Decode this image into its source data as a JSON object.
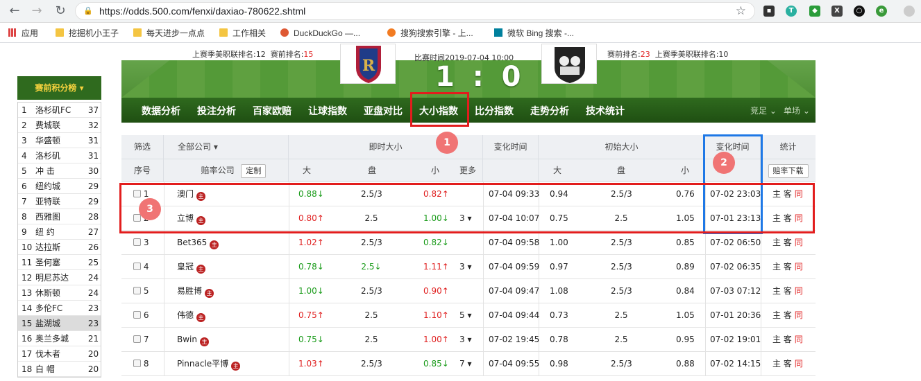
{
  "browser": {
    "url": "https://odds.500.com/fenxi/daxiao-780622.shtml",
    "bookmarks": [
      "应用",
      "挖掘机小王子",
      "每天进步一点点",
      "工作相关",
      "DuckDuckGo —...",
      "搜狗搜索引擎 - 上...",
      "微软 Bing 搜索 -..."
    ],
    "extensions": [
      "T",
      "X"
    ]
  },
  "match": {
    "left_rank_label": "上赛季美职联排名:12",
    "left_pre_label": "赛前排名:",
    "left_pre_value": "15",
    "time": "比赛时间2019-07-04 10:00",
    "score": "1 : 0",
    "right_pre_label": "赛前排名:",
    "right_pre_value": "23",
    "right_rank_label": "上赛季美职联排名:10"
  },
  "tabs": [
    "数据分析",
    "投注分析",
    "百家欧赔",
    "让球指数",
    "亚盘对比",
    "大小指数",
    "比分指数",
    "走势分析",
    "技术统计"
  ],
  "nav_right": [
    "竞足",
    "单场"
  ],
  "markers": [
    "1",
    "2",
    "3"
  ],
  "sidebar": {
    "title": "赛前积分榜 ▾",
    "teams": [
      {
        "n": "1",
        "name": "洛杉矶FC",
        "pts": "37"
      },
      {
        "n": "2",
        "name": "费城联",
        "pts": "32"
      },
      {
        "n": "3",
        "name": "华盛顿",
        "pts": "31"
      },
      {
        "n": "4",
        "name": "洛杉矶",
        "pts": "31"
      },
      {
        "n": "5",
        "name": "冲 击",
        "pts": "30"
      },
      {
        "n": "6",
        "name": "纽约城",
        "pts": "29"
      },
      {
        "n": "7",
        "name": "亚特联",
        "pts": "29"
      },
      {
        "n": "8",
        "name": "西雅图",
        "pts": "28"
      },
      {
        "n": "9",
        "name": "纽 约",
        "pts": "27"
      },
      {
        "n": "10",
        "name": "达拉斯",
        "pts": "26"
      },
      {
        "n": "11",
        "name": "圣何塞",
        "pts": "25"
      },
      {
        "n": "12",
        "name": "明尼苏达",
        "pts": "24"
      },
      {
        "n": "13",
        "name": "休斯顿",
        "pts": "24"
      },
      {
        "n": "14",
        "name": "多伦FC",
        "pts": "23"
      },
      {
        "n": "15",
        "name": "盐湖城",
        "pts": "23"
      },
      {
        "n": "16",
        "name": "奥兰多城",
        "pts": "21"
      },
      {
        "n": "17",
        "name": "伐木者",
        "pts": "20"
      },
      {
        "n": "18",
        "name": "白 帽",
        "pts": "20"
      }
    ]
  },
  "table": {
    "h1": {
      "filter": "筛选",
      "all": "全部公司 ▾",
      "live": "即时大小",
      "change": "变化时间",
      "init": "初始大小",
      "change2": "变化时间",
      "stat": "统计"
    },
    "h2": {
      "seq": "序号",
      "company": "赔率公司",
      "custom": "定制",
      "big": "大",
      "line": "盘",
      "small": "小",
      "more": "更多",
      "big2": "大",
      "line2": "盘",
      "small2": "小",
      "download": "赔率下载"
    },
    "rows": [
      {
        "no": "1",
        "co": "澳门",
        "b": "0.88↓",
        "bd": "down",
        "l": "2.5/3",
        "ld": "",
        "s": "0.82↑",
        "sd": "up",
        "more": "",
        "t": "07-04 09:33",
        "ib": "0.94",
        "il": "2.5/3",
        "is": "0.76",
        "it": "07-02 23:03"
      },
      {
        "no": "2",
        "co": "立博",
        "b": "0.80↑",
        "bd": "up",
        "l": "2.5",
        "ld": "",
        "s": "1.00↓",
        "sd": "down",
        "more": "3 ▾",
        "t": "07-04 10:07",
        "ib": "0.75",
        "il": "2.5",
        "is": "1.05",
        "it": "07-01 23:13"
      },
      {
        "no": "3",
        "co": "Bet365",
        "b": "1.02↑",
        "bd": "up",
        "l": "2.5/3",
        "ld": "",
        "s": "0.82↓",
        "sd": "down",
        "more": "",
        "t": "07-04 09:58",
        "ib": "1.00",
        "il": "2.5/3",
        "is": "0.85",
        "it": "07-02 06:50"
      },
      {
        "no": "4",
        "co": "皇冠",
        "b": "0.78↓",
        "bd": "down",
        "l": "2.5↓",
        "ld": "down",
        "s": "1.11↑",
        "sd": "up",
        "more": "3 ▾",
        "t": "07-04 09:59",
        "ib": "0.97",
        "il": "2.5/3",
        "is": "0.89",
        "it": "07-02 06:35"
      },
      {
        "no": "5",
        "co": "易胜博",
        "b": "1.00↓",
        "bd": "down",
        "l": "2.5/3",
        "ld": "",
        "s": "0.90↑",
        "sd": "up",
        "more": "",
        "t": "07-04 09:47",
        "ib": "1.08",
        "il": "2.5/3",
        "is": "0.84",
        "it": "07-03 07:12"
      },
      {
        "no": "6",
        "co": "伟德",
        "b": "0.75↑",
        "bd": "up",
        "l": "2.5",
        "ld": "",
        "s": "1.10↑",
        "sd": "up",
        "more": "5 ▾",
        "t": "07-04 09:44",
        "ib": "0.73",
        "il": "2.5",
        "is": "1.05",
        "it": "07-01 20:36"
      },
      {
        "no": "7",
        "co": "Bwin",
        "b": "0.75↓",
        "bd": "down",
        "l": "2.5",
        "ld": "",
        "s": "1.00↑",
        "sd": "up",
        "more": "3 ▾",
        "t": "07-02 19:45",
        "ib": "0.78",
        "il": "2.5",
        "is": "0.95",
        "it": "07-02 19:01"
      },
      {
        "no": "8",
        "co": "Pinnacle平博",
        "b": "1.03↑",
        "bd": "up",
        "l": "2.5/3",
        "ld": "",
        "s": "0.85↓",
        "sd": "down",
        "more": "7 ▾",
        "t": "07-04 09:55",
        "ib": "0.98",
        "il": "2.5/3",
        "is": "0.88",
        "it": "07-02 14:15"
      }
    ],
    "actions": {
      "home": "主",
      "away": "客",
      "same": "同"
    },
    "zhu": "主"
  }
}
